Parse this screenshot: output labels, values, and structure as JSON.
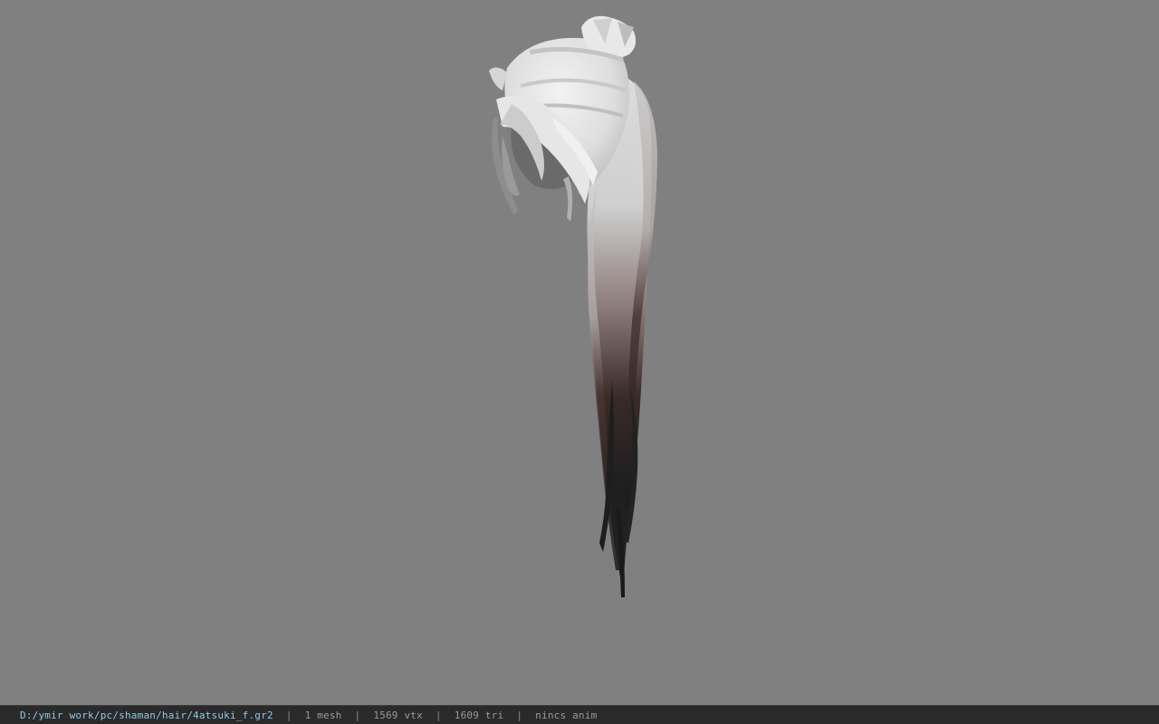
{
  "viewport": {
    "background_color": "#808080",
    "model_icon": "hair-model"
  },
  "status": {
    "file_path": "D:/ymir work/pc/shaman/hair/4atsuki_f.gr2",
    "separator": "|",
    "mesh_count": "1 mesh",
    "vertex_count": "1569 vtx",
    "triangle_count": "1609 tri",
    "anim_status": "nincs anim"
  }
}
